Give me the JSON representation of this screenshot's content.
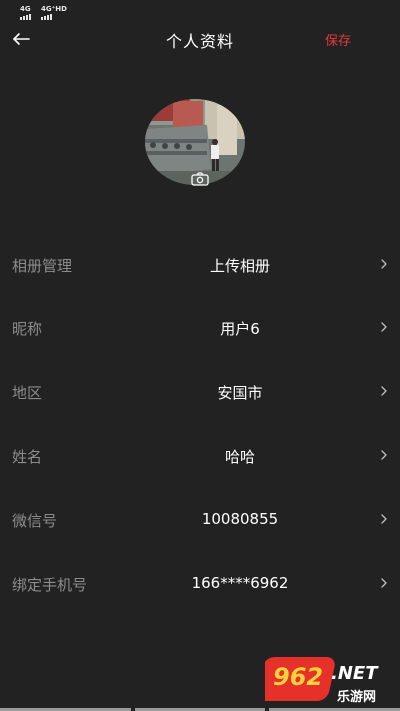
{
  "status_bar": {
    "signal_1": "4G",
    "signal_2": "4G⁺HD"
  },
  "header": {
    "title": "个人资料",
    "save_label": "保存"
  },
  "avatar": {
    "icon": "camera-icon"
  },
  "rows": [
    {
      "label": "相册管理",
      "value": "上传相册"
    },
    {
      "label": "昵称",
      "value": "用户6"
    },
    {
      "label": "地区",
      "value": "安国市"
    },
    {
      "label": "姓名",
      "value": "哈哈"
    },
    {
      "label": "微信号",
      "value": "10080855"
    },
    {
      "label": "绑定手机号",
      "value": "166****6962"
    }
  ],
  "watermark": {
    "logo_text": "962.NET",
    "site_text": "乐游网"
  },
  "colors": {
    "background": "#222222",
    "accent": "#e23b3b",
    "label": "#8c8c8c",
    "value": "#ffffff"
  }
}
